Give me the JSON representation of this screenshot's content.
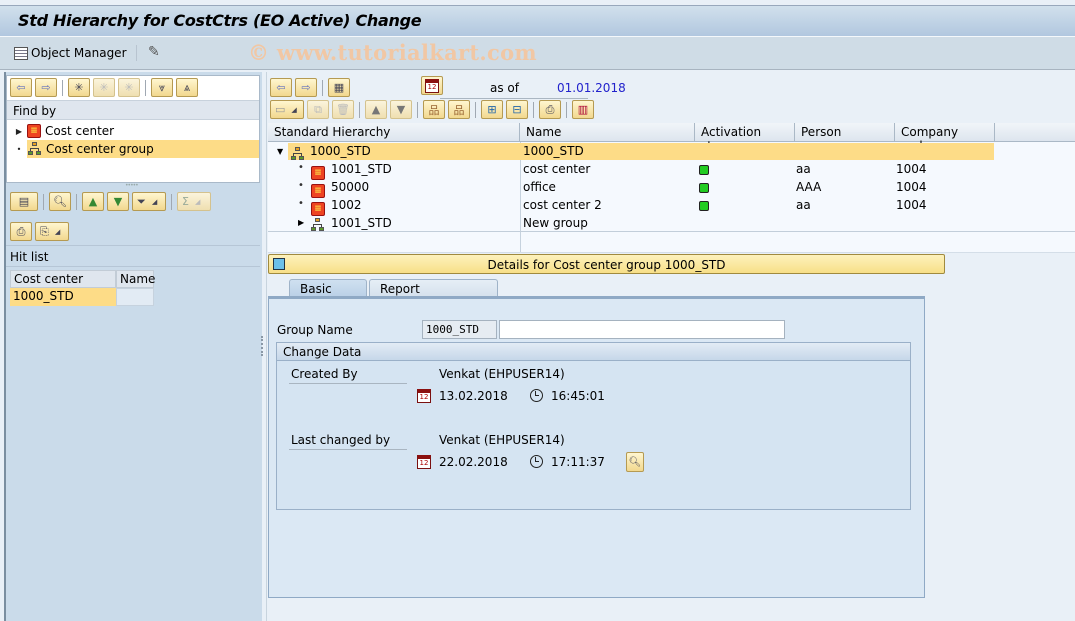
{
  "window": {
    "title": "Std Hierarchy for CostCtrs (EO Active) Change"
  },
  "app_toolbar": {
    "object_manager_label": "Object Manager",
    "watermark": "© www.tutorialkart.com"
  },
  "left_pane": {
    "find_by_label": "Find by",
    "find_items": [
      {
        "label": "Cost center",
        "icon": "cost-center-icon",
        "expandable": true,
        "selected": false
      },
      {
        "label": "Cost center group",
        "icon": "cost-center-group-icon",
        "expandable": false,
        "selected": true
      }
    ],
    "hit_list_label": "Hit list",
    "hit_list_columns": [
      "Cost center group",
      "Name"
    ],
    "hit_list_rows": [
      {
        "group": "1000_STD",
        "name": ""
      }
    ]
  },
  "hierarchy": {
    "as_of_label": "as of",
    "as_of_date": "01.01.2018",
    "columns": [
      "Standard Hierarchy",
      "Name",
      "Activation sta...",
      "Person respo...",
      "Company code"
    ],
    "rows": [
      {
        "node": "1000_STD",
        "name": "1000_STD",
        "type": "group",
        "expanded": true,
        "level": 0,
        "active": false,
        "person": "",
        "company": "",
        "selected": true
      },
      {
        "node": "1001_STD",
        "name": "cost center",
        "type": "cost-center",
        "level": 1,
        "active": true,
        "person": "aa",
        "company": "1004"
      },
      {
        "node": "50000",
        "name": "office",
        "type": "cost-center",
        "level": 1,
        "active": true,
        "person": "AAA",
        "company": "1004"
      },
      {
        "node": "1002",
        "name": "cost center 2",
        "type": "cost-center",
        "level": 1,
        "active": true,
        "person": "aa",
        "company": "1004"
      },
      {
        "node": "1001_STD",
        "name": "New group",
        "type": "group",
        "level": 1,
        "expandable": true,
        "active": false,
        "person": "",
        "company": ""
      }
    ],
    "status_color": "#22cc22"
  },
  "details": {
    "header": "Details for Cost center group 1000_STD",
    "tabs": [
      {
        "label": "Basic data",
        "active": true
      },
      {
        "label": "Report information",
        "active": false
      }
    ],
    "group_name_label": "Group Name",
    "group_name_value": "1000_STD",
    "group_description_value": "",
    "change_data": {
      "title": "Change Data",
      "created_by_label": "Created By",
      "created_by_value": "Venkat (EHPUSER14)",
      "created_date": "13.02.2018",
      "created_time": "16:45:01",
      "last_changed_label": "Last changed by",
      "last_changed_value": "Venkat (EHPUSER14)",
      "last_changed_date": "22.02.2018",
      "last_changed_time": "17:11:37"
    }
  },
  "colors": {
    "selection": "#fddc87",
    "accent_date": "#2222cc"
  }
}
